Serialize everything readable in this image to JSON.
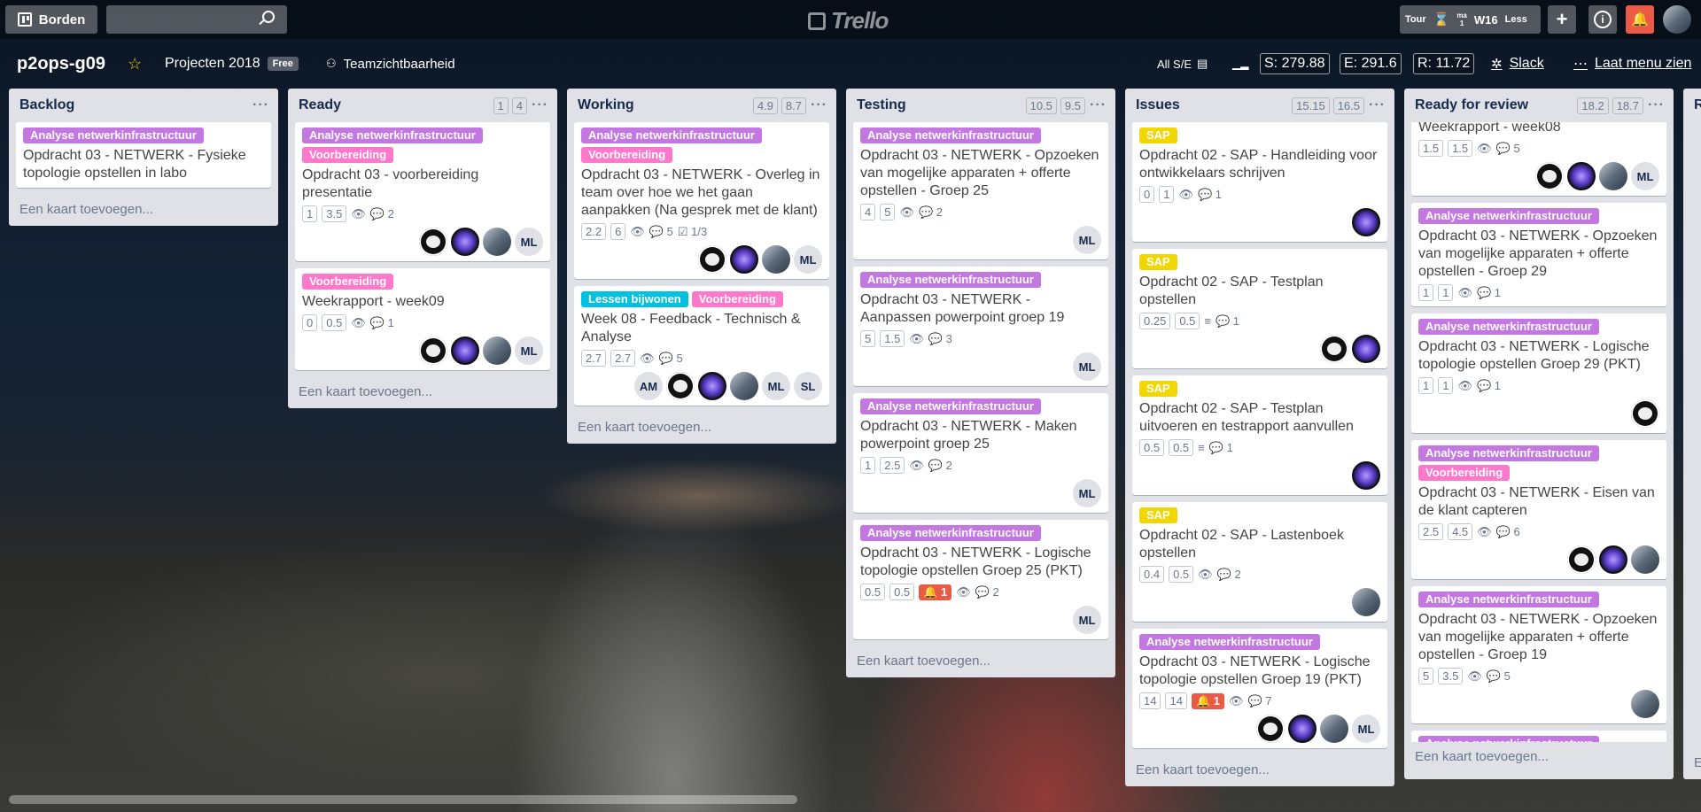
{
  "topbar": {
    "boards_label": "Borden",
    "search_placeholder": "",
    "logo": "Trello",
    "tour": "Tour",
    "ma": "ma",
    "ma_num": "1",
    "week": "W16",
    "less": "Less"
  },
  "board": {
    "name": "p2ops-g09",
    "team": "Projecten 2018",
    "plan": "Free",
    "visibility": "Teamzichtbaarheid",
    "all": "All S/E",
    "s": "S: 279.88",
    "e": "E: 291.6",
    "r": "R: 11.72",
    "slack": "Slack",
    "menu": "Laat menu zien"
  },
  "add_card": "Een kaart toevoegen...",
  "lists": [
    {
      "name": "Backlog",
      "c1": "",
      "c2": "",
      "cards": [
        {
          "labels": [
            {
              "text": "Analyse netwerkinfrastructuur",
              "color": "purple"
            }
          ],
          "title": "Opdracht 03 - NETWERK - Fysieke topologie opstellen in labo"
        }
      ]
    },
    {
      "name": "Ready",
      "c1": "1",
      "c2": "4",
      "cards": [
        {
          "labels": [
            {
              "text": "Analyse netwerkinfrastructuur",
              "color": "purple"
            },
            {
              "text": "Voorbereiding",
              "color": "pink"
            }
          ],
          "title": "Opdracht 03 - voorbereiding presentatie",
          "b1": "1",
          "b2": "3.5",
          "comments": "2",
          "members": [
            "dog",
            "purp",
            "photo",
            "ML"
          ]
        },
        {
          "labels": [
            {
              "text": "Voorbereiding",
              "color": "pink"
            }
          ],
          "title": "Weekrapport - week09",
          "b1": "0",
          "b2": "0.5",
          "comments": "1",
          "members": [
            "dog",
            "purp",
            "photo",
            "ML"
          ]
        }
      ]
    },
    {
      "name": "Working",
      "c1": "4.9",
      "c2": "8.7",
      "cards": [
        {
          "labels": [
            {
              "text": "Analyse netwerkinfrastructuur",
              "color": "purple"
            },
            {
              "text": "Voorbereiding",
              "color": "pink"
            }
          ],
          "title": "Opdracht 03 - NETWERK - Overleg in team over hoe we het gaan aanpakken (Na gesprek met de klant)",
          "b1": "2.2",
          "b2": "6",
          "comments": "5",
          "check": "1/3",
          "members": [
            "dog",
            "purp",
            "photo",
            "ML"
          ]
        },
        {
          "labels": [
            {
              "text": "Lessen bijwonen",
              "color": "sky"
            },
            {
              "text": "Voorbereiding",
              "color": "pink"
            }
          ],
          "title": "Week 08 - Feedback - Technisch & Analyse",
          "b1": "2.7",
          "b2": "2.7",
          "comments": "5",
          "members": [
            "AM",
            "dog",
            "purp",
            "photo",
            "ML",
            "SL"
          ]
        }
      ]
    },
    {
      "name": "Testing",
      "c1": "10.5",
      "c2": "9.5",
      "cards": [
        {
          "labels": [
            {
              "text": "Analyse netwerkinfrastructuur",
              "color": "purple"
            }
          ],
          "title": "Opdracht 03 - NETWERK - Opzoeken van mogelijke apparaten + offerte opstellen - Groep 25",
          "b1": "4",
          "b2": "5",
          "comments": "2",
          "members": [
            "ML"
          ]
        },
        {
          "labels": [
            {
              "text": "Analyse netwerkinfrastructuur",
              "color": "purple"
            }
          ],
          "title": "Opdracht 03 - NETWERK - Aanpassen powerpoint groep 19",
          "b1": "5",
          "b2": "1.5",
          "comments": "3",
          "members": [
            "ML"
          ]
        },
        {
          "labels": [
            {
              "text": "Analyse netwerkinfrastructuur",
              "color": "purple"
            }
          ],
          "title": "Opdracht 03 - NETWERK - Maken powerpoint groep 25",
          "b1": "1",
          "b2": "2.5",
          "comments": "2",
          "members": [
            "ML"
          ]
        },
        {
          "labels": [
            {
              "text": "Analyse netwerkinfrastructuur",
              "color": "purple"
            }
          ],
          "title": "Opdracht 03 - NETWERK - Logische topologie opstellen Groep 25 (PKT)",
          "b1": "0.5",
          "b2": "0.5",
          "alert": "1",
          "comments": "2",
          "members": [
            "ML"
          ]
        }
      ]
    },
    {
      "name": "Issues",
      "c1": "15.15",
      "c2": "16.5",
      "cards": [
        {
          "labels": [
            {
              "text": "SAP",
              "color": "yellow"
            }
          ],
          "title": "Opdracht 02 - SAP - Handleiding voor ontwikkelaars schrijven",
          "b1": "0",
          "b2": "1",
          "comments": "1",
          "members": [
            "purp"
          ]
        },
        {
          "labels": [
            {
              "text": "SAP",
              "color": "yellow"
            }
          ],
          "title": "Opdracht 02 - SAP - Testplan opstellen",
          "b1": "0.25",
          "b2": "0.5",
          "desc": true,
          "comments": "1",
          "members": [
            "dog",
            "purp"
          ]
        },
        {
          "labels": [
            {
              "text": "SAP",
              "color": "yellow"
            }
          ],
          "title": "Opdracht 02 - SAP - Testplan uitvoeren en testrapport aanvullen",
          "b1": "0.5",
          "b2": "0.5",
          "desc": true,
          "comments": "1",
          "members": [
            "purp"
          ]
        },
        {
          "labels": [
            {
              "text": "SAP",
              "color": "yellow"
            }
          ],
          "title": "Opdracht 02 - SAP - Lastenboek opstellen",
          "b1": "0.4",
          "b2": "0.5",
          "eye": true,
          "comments": "2",
          "members": [
            "photo"
          ]
        },
        {
          "labels": [
            {
              "text": "Analyse netwerkinfrastructuur",
              "color": "purple"
            }
          ],
          "title": "Opdracht 03 - NETWERK - Logische topologie opstellen Groep 19 (PKT)",
          "b1": "14",
          "b2": "14",
          "alert": "1",
          "comments": "7",
          "members": [
            "dog",
            "purp",
            "photo",
            "ML"
          ]
        }
      ]
    },
    {
      "name": "Ready for review",
      "c1": "18.2",
      "c2": "18.7",
      "cards": [
        {
          "labels": [],
          "title": "Weekrapport - week08",
          "b1": "1.5",
          "b2": "1.5",
          "comments": "5",
          "members": [
            "dog",
            "purp",
            "photo",
            "ML"
          ]
        },
        {
          "labels": [
            {
              "text": "Analyse netwerkinfrastructuur",
              "color": "purple"
            }
          ],
          "title": "Opdracht 03 - NETWERK - Opzoeken van mogelijke apparaten + offerte opstellen - Groep 29",
          "b1": "1",
          "b2": "1",
          "comments": "1"
        },
        {
          "labels": [
            {
              "text": "Analyse netwerkinfrastructuur",
              "color": "purple"
            }
          ],
          "title": "Opdracht 03 - NETWERK - Logische topologie opstellen Groep 29 (PKT)",
          "b1": "1",
          "b2": "1",
          "comments": "1",
          "members": [
            "dog"
          ]
        },
        {
          "labels": [
            {
              "text": "Analyse netwerkinfrastructuur",
              "color": "purple"
            },
            {
              "text": "Voorbereiding",
              "color": "pink"
            }
          ],
          "title": "Opdracht 03 - NETWERK - Eisen van de klant capteren",
          "b1": "2.5",
          "b2": "4.5",
          "comments": "6",
          "members": [
            "dog",
            "purp",
            "photo"
          ]
        },
        {
          "labels": [
            {
              "text": "Analyse netwerkinfrastructuur",
              "color": "purple"
            }
          ],
          "title": "Opdracht 03 - NETWERK - Opzoeken van mogelijke apparaten + offerte opstellen - Groep 19",
          "b1": "5",
          "b2": "3.5",
          "comments": "5",
          "members": [
            "photo"
          ]
        },
        {
          "labels": [
            {
              "text": "Analyse netwerkinfrastructuur",
              "color": "purple"
            }
          ],
          "title": ""
        }
      ]
    }
  ],
  "partial_list": {
    "name": "R",
    "add": "E"
  }
}
